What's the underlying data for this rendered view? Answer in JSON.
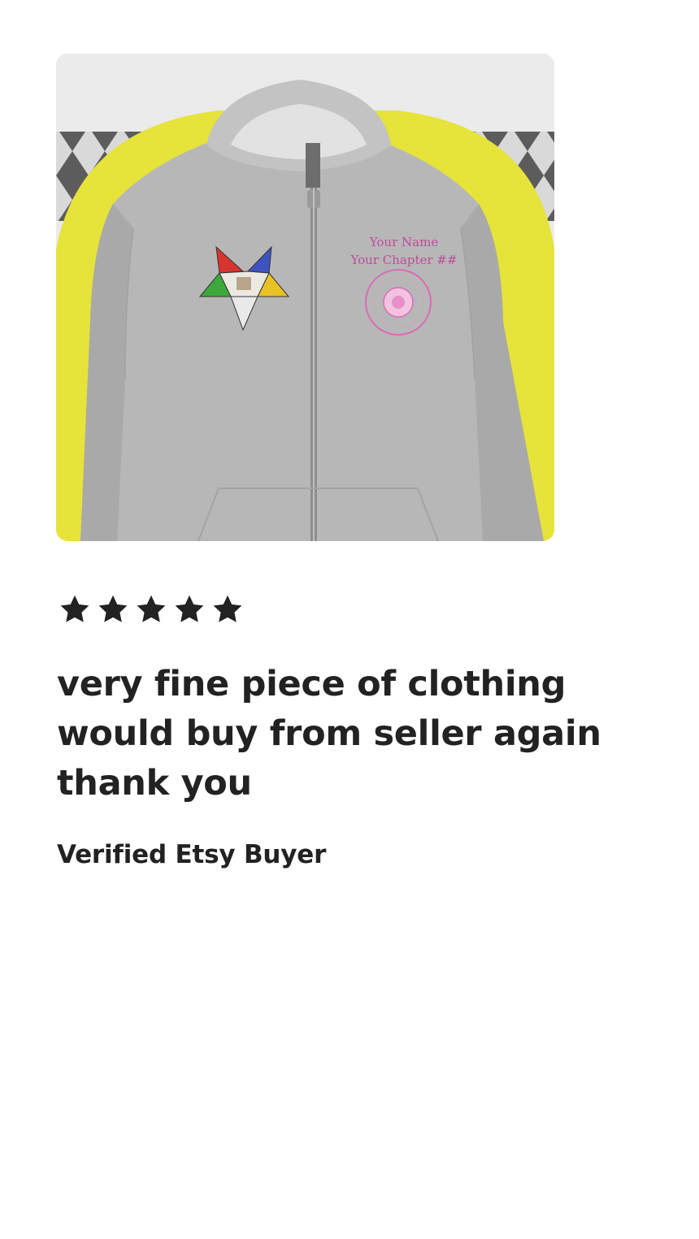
{
  "product_photo": {
    "print_name": "Your Name",
    "print_chapter": "Your Chapter ##",
    "colors": {
      "backdrop": "#ebebeb",
      "accent_yellow": "#e6e33a",
      "hoodie_gray": "#b9b9b9",
      "print_pink": "#c24a9c"
    }
  },
  "rating": {
    "value": 5,
    "max": 5,
    "star_color": "#222222",
    "icon": "star-icon"
  },
  "review": {
    "text": "very fine piece of clothing would buy from seller again thank you",
    "author": "Verified Etsy Buyer"
  }
}
